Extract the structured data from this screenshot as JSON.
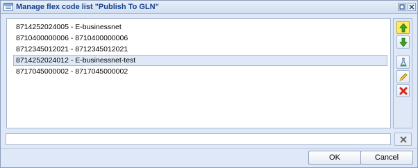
{
  "window": {
    "title": "Manage flex code list \"Publish To GLN\""
  },
  "list": {
    "items": [
      {
        "label": "8714252024005 - E-businessnet",
        "selected": false
      },
      {
        "label": "8710400000006 - 8710400000006",
        "selected": false
      },
      {
        "label": "8712345012021 - 8712345012021",
        "selected": false
      },
      {
        "label": "8714252024012 - E-businessnet-test",
        "selected": true
      },
      {
        "label": "8717045000002 - 8717045000002",
        "selected": false
      }
    ]
  },
  "side_buttons": [
    {
      "name": "move-up",
      "icon": "arrow-up-icon",
      "color": "#3aa527"
    },
    {
      "name": "move-down",
      "icon": "arrow-down-icon",
      "color": "#3aa527"
    },
    {
      "name": "add",
      "icon": "flask-icon"
    },
    {
      "name": "edit",
      "icon": "pencil-icon"
    },
    {
      "name": "delete",
      "icon": "red-x-icon",
      "color": "#d9261c"
    }
  ],
  "input": {
    "value": "",
    "placeholder": ""
  },
  "buttons": {
    "ok_label": "OK",
    "cancel_label": "Cancel"
  }
}
